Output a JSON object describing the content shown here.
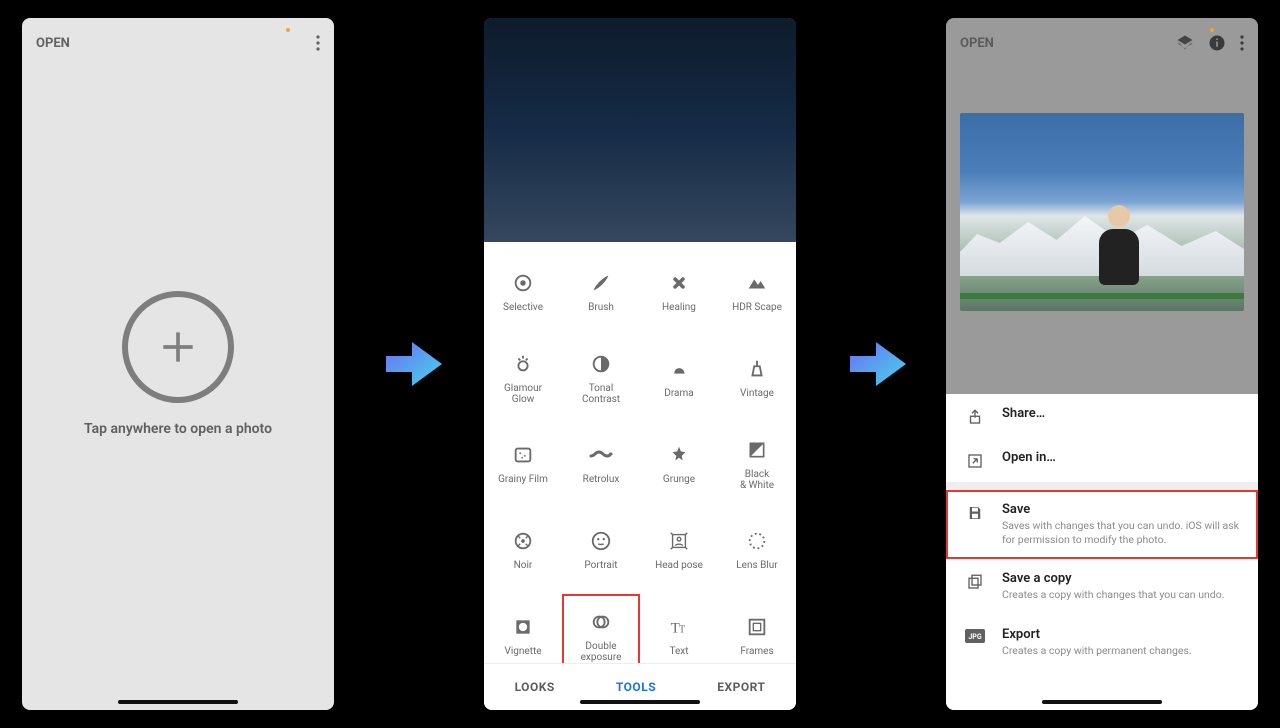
{
  "screen1": {
    "open": "OPEN",
    "tap_text": "Tap anywhere to open a photo"
  },
  "screen2": {
    "tools": [
      {
        "id": "selective",
        "label": "Selective"
      },
      {
        "id": "brush",
        "label": "Brush"
      },
      {
        "id": "healing",
        "label": "Healing"
      },
      {
        "id": "hdr-scape",
        "label": "HDR Scape"
      },
      {
        "id": "glamour-glow",
        "label": "Glamour\nGlow"
      },
      {
        "id": "tonal-contrast",
        "label": "Tonal\nContrast"
      },
      {
        "id": "drama",
        "label": "Drama"
      },
      {
        "id": "vintage",
        "label": "Vintage"
      },
      {
        "id": "grainy-film",
        "label": "Grainy Film"
      },
      {
        "id": "retrolux",
        "label": "Retrolux"
      },
      {
        "id": "grunge",
        "label": "Grunge"
      },
      {
        "id": "black-white",
        "label": "Black\n& White"
      },
      {
        "id": "noir",
        "label": "Noir"
      },
      {
        "id": "portrait",
        "label": "Portrait"
      },
      {
        "id": "head-pose",
        "label": "Head pose"
      },
      {
        "id": "lens-blur",
        "label": "Lens Blur"
      },
      {
        "id": "vignette",
        "label": "Vignette"
      },
      {
        "id": "double-exposure",
        "label": "Double\nexposure",
        "highlight": true
      },
      {
        "id": "text",
        "label": "Text"
      },
      {
        "id": "frames",
        "label": "Frames"
      }
    ],
    "tabs": {
      "looks": "LOOKS",
      "tools": "TOOLS",
      "export": "EXPORT"
    }
  },
  "screen3": {
    "open": "OPEN",
    "rows": [
      {
        "id": "share",
        "title": "Share…",
        "desc": ""
      },
      {
        "id": "open-in",
        "title": "Open in…",
        "desc": ""
      },
      {
        "id": "save",
        "title": "Save",
        "desc": "Saves with changes that you can undo. iOS will ask for permission to modify the photo.",
        "highlight": true
      },
      {
        "id": "save-copy",
        "title": "Save a copy",
        "desc": "Creates a copy with changes that you can undo."
      },
      {
        "id": "export",
        "title": "Export",
        "desc": "Creates a copy with permanent changes."
      }
    ]
  }
}
